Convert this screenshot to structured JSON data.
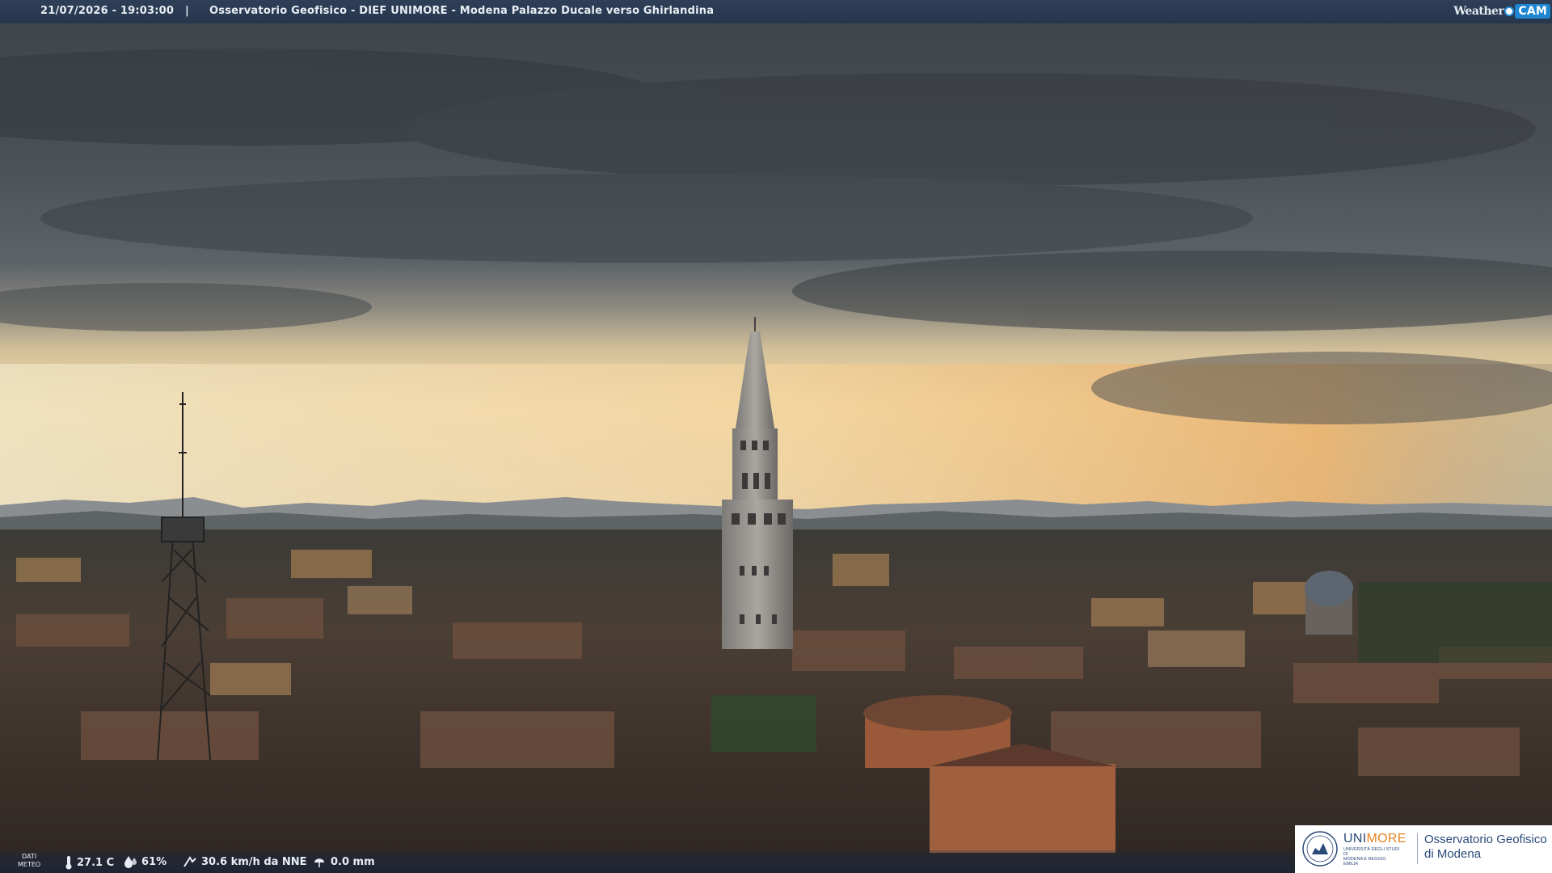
{
  "header": {
    "timestamp": "21/07/2026 - 19:03:00",
    "separator": "|",
    "title": "Osservatorio Geofisico - DIEF UNIMORE - Modena Palazzo Ducale verso Ghirlandina"
  },
  "brand": {
    "weather": "Weather",
    "cam": "CAM"
  },
  "meteo": {
    "label_line1": "DATI",
    "label_line2": "METEO",
    "temperature": "27.1 C",
    "humidity": "61%",
    "wind": "30.6 km/h da NNE",
    "rain": "0.0 mm"
  },
  "logo": {
    "uni_part1": "UNI",
    "uni_part2": "MORE",
    "sub_line1": "UNIVERSITÀ DEGLI STUDI DI",
    "sub_line2": "MODENA E REGGIO EMILIA",
    "name_line1": "Osservatorio Geofisico",
    "name_line2": "di Modena"
  },
  "icons": [
    "thermometer-icon",
    "humidity-drop-icon",
    "wind-icon",
    "rain-icon",
    "weathercam-dot-icon",
    "unimore-seal-icon"
  ],
  "colors": {
    "header_bg": "#2a3b53",
    "brand_blue": "#1f86d2",
    "unimore_blue": "#2b4a7a",
    "unimore_orange": "#e2831f"
  }
}
